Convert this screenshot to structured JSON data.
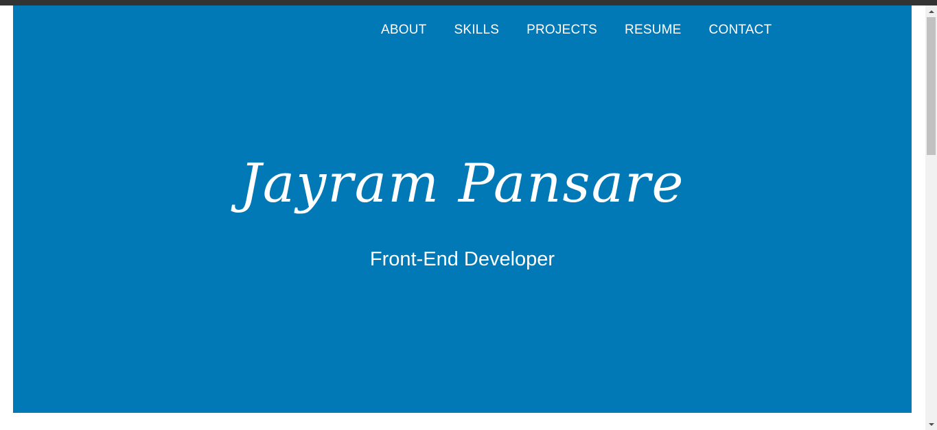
{
  "nav": {
    "items": [
      {
        "label": "ABOUT"
      },
      {
        "label": "SKILLS"
      },
      {
        "label": "PROJECTS"
      },
      {
        "label": "RESUME"
      },
      {
        "label": "CONTACT"
      }
    ]
  },
  "hero": {
    "name": "Jayram Pansare",
    "role": "Front-End Developer"
  },
  "colors": {
    "hero_background": "#0079b6",
    "text": "#ffffff"
  }
}
